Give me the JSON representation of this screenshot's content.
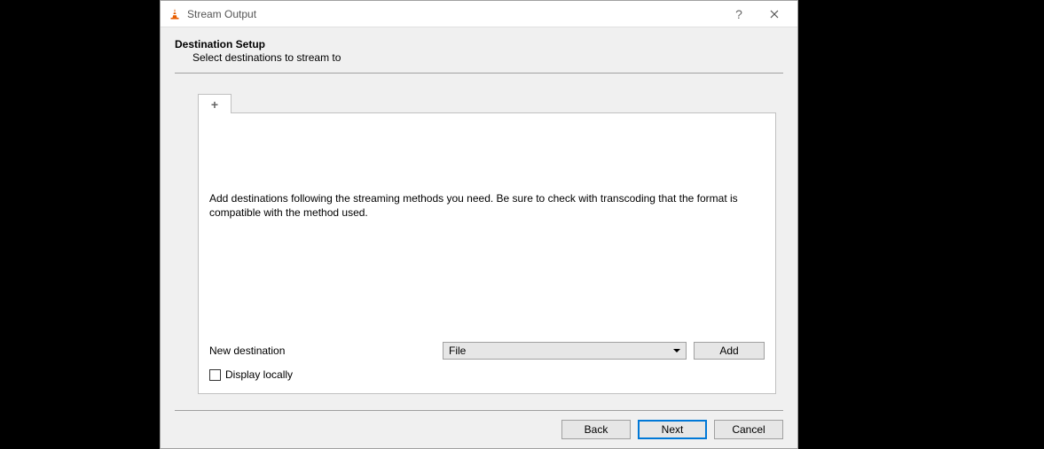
{
  "window": {
    "title": "Stream Output"
  },
  "section": {
    "title": "Destination Setup",
    "subtitle": "Select destinations to stream to"
  },
  "tab": {
    "plus_label": "+"
  },
  "panel": {
    "description": "Add destinations following the streaming methods you need. Be sure to check with transcoding that the format is compatible with the method used.",
    "new_destination_label": "New destination",
    "destination_select_value": "File",
    "add_button_label": "Add",
    "display_locally_label": "Display locally"
  },
  "footer": {
    "back_label": "Back",
    "next_label": "Next",
    "cancel_label": "Cancel"
  }
}
